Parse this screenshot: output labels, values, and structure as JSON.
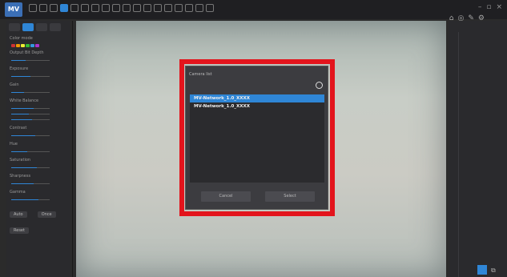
{
  "app": {
    "logo_text": "MV"
  },
  "toolbar": {
    "icons": [
      "open-icon",
      "save-icon",
      "grid-icon",
      "select-icon",
      "crop-icon",
      "undo-icon",
      "redo-icon",
      "zoom-icon",
      "fit-icon",
      "brush-icon",
      "pen-icon",
      "shape-icon",
      "measure-icon",
      "text-icon",
      "color-icon",
      "layers-icon",
      "image-icon",
      "video-icon"
    ],
    "window_controls": [
      "–",
      "▫",
      "×"
    ],
    "secondary_icons": [
      "⌂",
      "◎",
      "✎",
      "⚙"
    ]
  },
  "left_panel": {
    "labels": [
      "Color mode",
      "Output Bit Depth",
      "Exposure",
      "Gain",
      "White Balance",
      "Contrast",
      "Hue",
      "Saturation",
      "Sharpness",
      "Gamma"
    ],
    "buttons": [
      "Auto",
      "Once",
      "Reset"
    ]
  },
  "dialog": {
    "title": "Camera list",
    "items": [
      "MV-Network_1.0_XXXX",
      "MV-Network_1.0_XXXX"
    ],
    "cancel_label": "Cancel",
    "select_label": "Select"
  },
  "colors": {
    "accent": "#2f86d6",
    "highlight": "#e3141c"
  }
}
